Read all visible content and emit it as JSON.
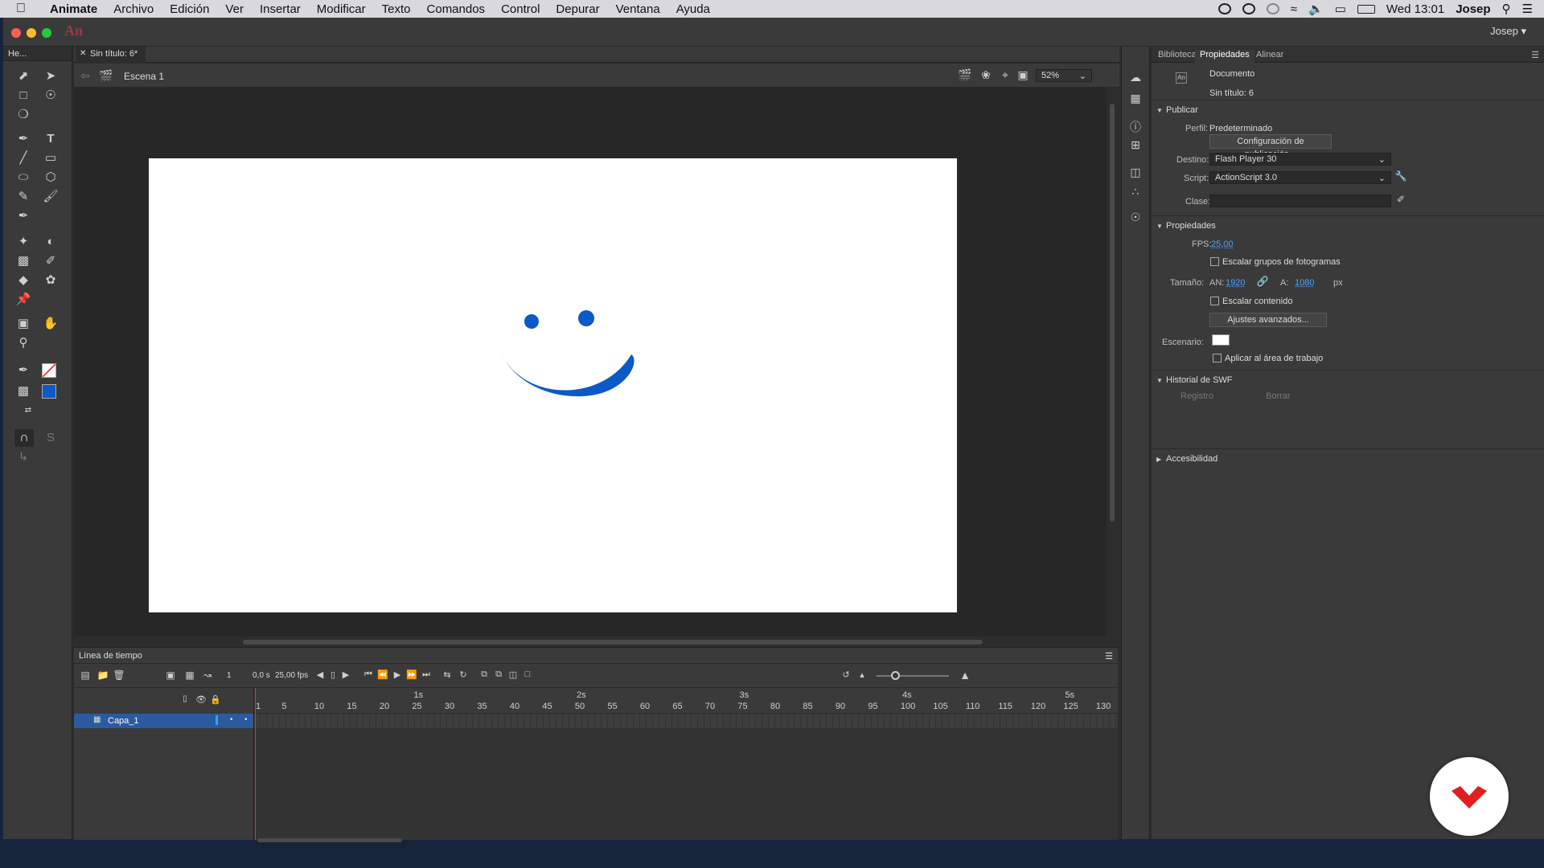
{
  "menubar": {
    "app": "Animate",
    "items": [
      "Archivo",
      "Edición",
      "Ver",
      "Insertar",
      "Modificar",
      "Texto",
      "Comandos",
      "Control",
      "Depurar",
      "Ventana",
      "Ayuda"
    ],
    "clock": "Wed 13:01",
    "user": "Josep"
  },
  "window": {
    "app_logo": "An",
    "user": "Josep"
  },
  "tools_panel": {
    "header": "He..."
  },
  "document": {
    "tab_label": "Sin título: 6*",
    "scene": "Escena 1",
    "zoom": "52%"
  },
  "timeline": {
    "title": "Línea de tiempo",
    "current_frame": "1",
    "time": "0,0 s",
    "fps": "25,00 fps",
    "seconds": [
      "1s",
      "2s",
      "3s",
      "4s",
      "5s"
    ],
    "frame_ticks": [
      "1",
      "5",
      "10",
      "15",
      "20",
      "25",
      "30",
      "35",
      "40",
      "45",
      "50",
      "55",
      "60",
      "65",
      "70",
      "75",
      "80",
      "85",
      "90",
      "95",
      "100",
      "105",
      "110",
      "115",
      "120",
      "125",
      "130"
    ],
    "layer_name": "Capa_1"
  },
  "properties": {
    "tabs": [
      "Biblioteca",
      "Propiedades",
      "Alinear"
    ],
    "doc_type": "Documento",
    "doc_name": "Sin título: 6",
    "publish_section": "Publicar",
    "profile_label": "Perfil:",
    "profile_value": "Predeterminado",
    "publish_settings_button": "Configuración de publicación...",
    "target_label": "Destino:",
    "target_value": "Flash Player 30",
    "script_label": "Script:",
    "script_value": "ActionScript 3.0",
    "class_label": "Clase:",
    "class_value": "",
    "properties_section": "Propiedades",
    "fps_label": "FPS:",
    "fps_value": "25,00",
    "scale_spans_label": "Escalar grupos de fotogramas",
    "size_label": "Tamaño:",
    "width_label": "AN:",
    "width_value": "1920",
    "height_label": "A:",
    "height_value": "1080",
    "unit": "px",
    "scale_content_label": "Escalar contenido",
    "advanced_button": "Ajustes avanzados...",
    "stage_label": "Escenario:",
    "stage_color": "#ffffff",
    "apply_pasteboard_label": "Aplicar al área de trabajo",
    "swf_history_section": "Historial de SWF",
    "log_button": "Registro",
    "clear_button": "Borrar",
    "accessibility_section": "Accesibilidad"
  },
  "colors": {
    "stroke": "#ffffff",
    "fill": "#0c5ac8",
    "smiley": "#0c5ac8",
    "layer_highlight": "#2c5a9e"
  }
}
